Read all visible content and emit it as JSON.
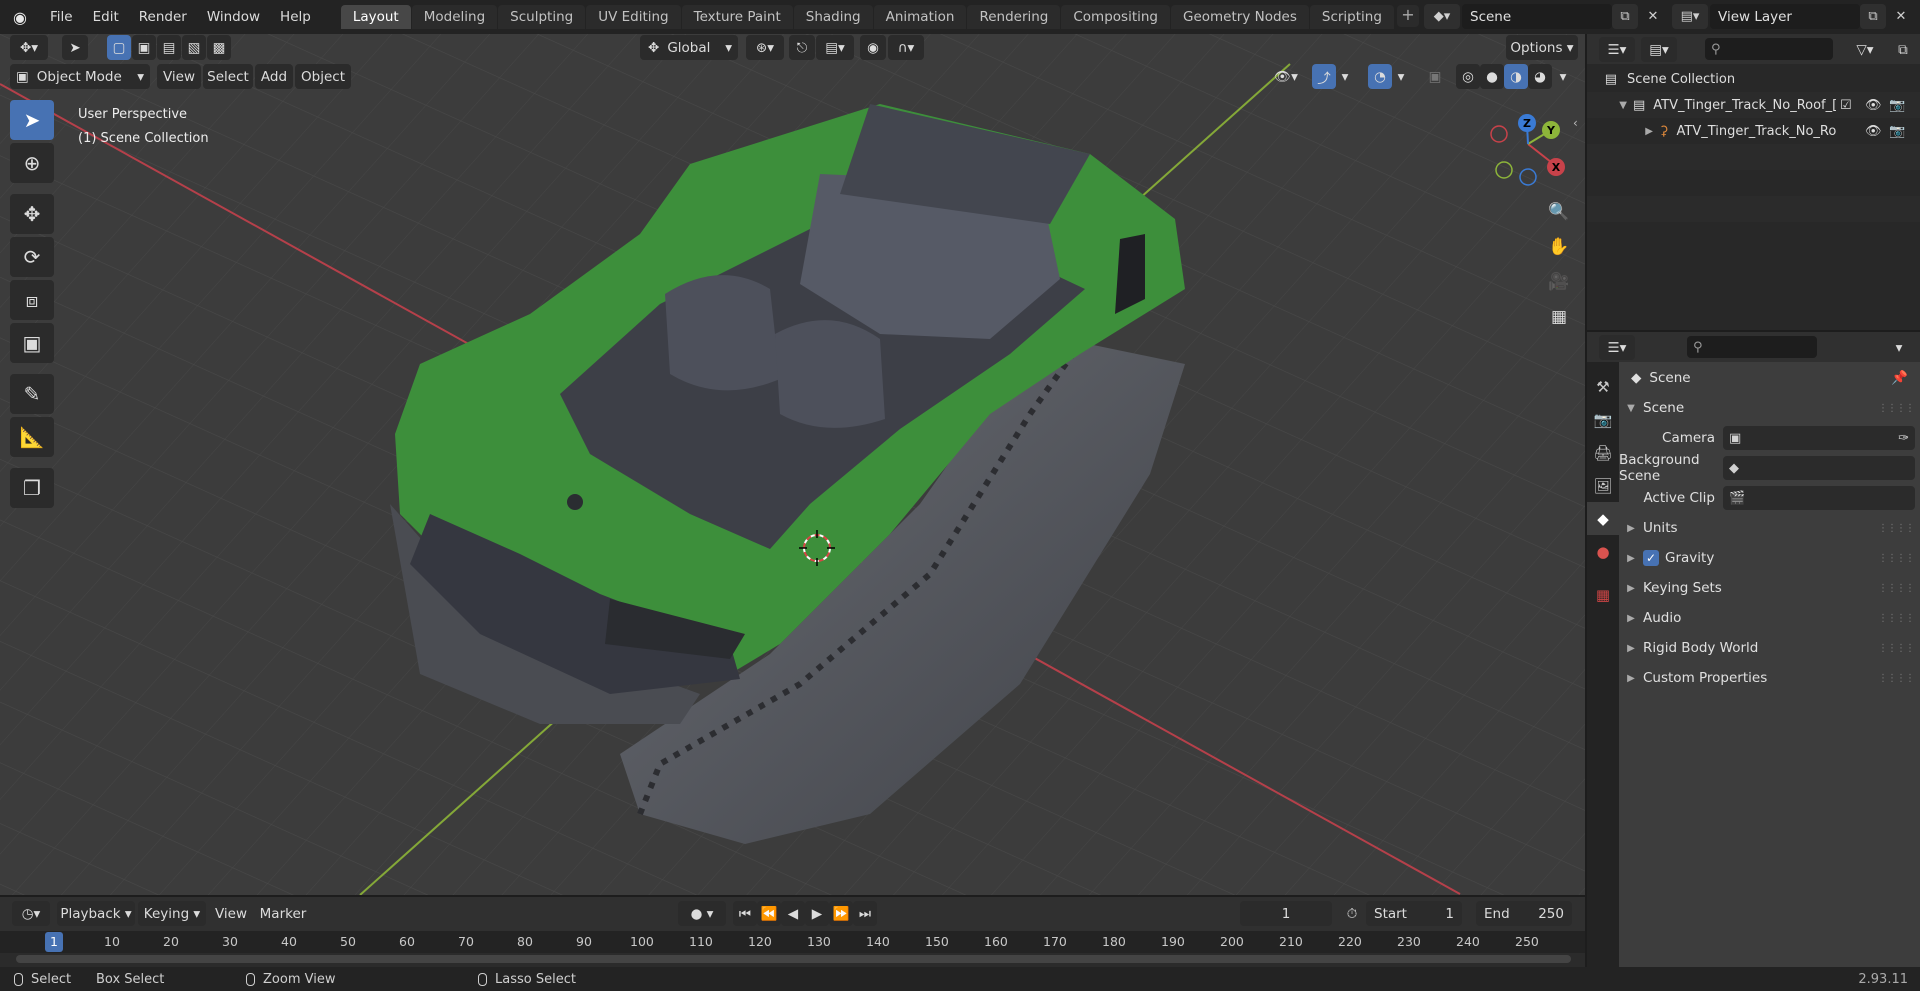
{
  "menu": [
    "File",
    "Edit",
    "Render",
    "Window",
    "Help"
  ],
  "workspaces": [
    "Layout",
    "Modeling",
    "Sculpting",
    "UV Editing",
    "Texture Paint",
    "Shading",
    "Animation",
    "Rendering",
    "Compositing",
    "Geometry Nodes",
    "Scripting"
  ],
  "active_workspace": "Layout",
  "scene_name": "Scene",
  "view_layer": "View Layer",
  "viewport": {
    "transform_orientation": "Global",
    "options_label": "Options",
    "mode": "Object Mode",
    "menus": [
      "View",
      "Select",
      "Add",
      "Object"
    ],
    "overlay_title": "User Perspective",
    "overlay_collection": "(1) Scene Collection",
    "gizmo_axes": {
      "x": "X",
      "y": "Y",
      "z": "Z"
    }
  },
  "outliner": {
    "root": "Scene Collection",
    "collection": "ATV_Tinger_Track_No_Roof_[",
    "object": "ATV_Tinger_Track_No_Ro"
  },
  "properties": {
    "header_title": "Scene",
    "panel_title": "Scene",
    "camera_label": "Camera",
    "background_scene_label": "Background Scene",
    "active_clip_label": "Active Clip",
    "sections": [
      "Units",
      "Gravity",
      "Keying Sets",
      "Audio",
      "Rigid Body World",
      "Custom Properties"
    ],
    "gravity_checked": true
  },
  "timeline": {
    "menus": [
      "Playback",
      "Keying",
      "View",
      "Marker"
    ],
    "current_frame": "1",
    "start_label": "Start",
    "start_value": "1",
    "end_label": "End",
    "end_value": "250",
    "ticks": [
      "10",
      "20",
      "30",
      "40",
      "50",
      "60",
      "70",
      "80",
      "90",
      "100",
      "110",
      "120",
      "130",
      "140",
      "150",
      "160",
      "170",
      "180",
      "190",
      "200",
      "210",
      "220",
      "230",
      "240",
      "250"
    ]
  },
  "statusbar": {
    "select": "Select",
    "box_select": "Box Select",
    "zoom_view": "Zoom View",
    "lasso_select": "Lasso Select",
    "version": "2.93.11"
  },
  "colors": {
    "accent": "#4772b3",
    "axis_x": "#c8424a",
    "axis_y": "#8db53a",
    "axis_z": "#3a7bd6",
    "vehicle_green": "#3d8f3b",
    "vehicle_grey": "#4e5261"
  }
}
